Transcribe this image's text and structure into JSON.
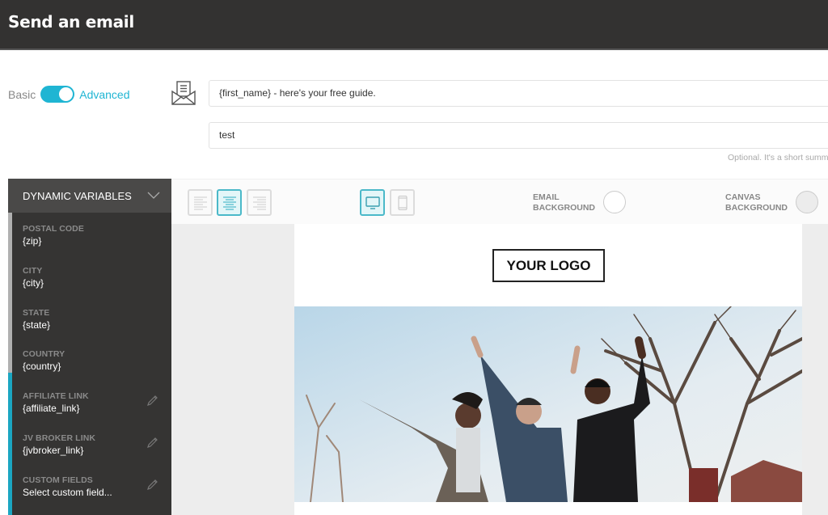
{
  "header": {
    "title": "Send an email"
  },
  "mode_toggle": {
    "left_label": "Basic",
    "right_label": "Advanced",
    "state": "advanced"
  },
  "subject": {
    "value": "{first_name} - here's your free guide."
  },
  "preview_text": {
    "value": "test",
    "hint": "Optional. It's a short summ"
  },
  "sidebar": {
    "title": "DYNAMIC VARIABLES",
    "items": [
      {
        "label": "POSTAL CODE",
        "value": "{zip}",
        "editable": false
      },
      {
        "label": "CITY",
        "value": "{city}",
        "editable": false
      },
      {
        "label": "STATE",
        "value": "{state}",
        "editable": false
      },
      {
        "label": "COUNTRY",
        "value": "{country}",
        "editable": false
      },
      {
        "label": "AFFILIATE LINK",
        "value": "{affiliate_link}",
        "editable": true
      },
      {
        "label": "JV BROKER LINK",
        "value": "{jvbroker_link}",
        "editable": true
      },
      {
        "label": "CUSTOM FIELDS",
        "value": "Select custom field...",
        "editable": true
      }
    ]
  },
  "toolbar": {
    "align_options": [
      "align-left",
      "align-center",
      "align-right"
    ],
    "align_selected": "align-center",
    "view_options": [
      "desktop",
      "mobile"
    ],
    "view_selected": "desktop",
    "email_background": {
      "line1": "EMAIL",
      "line2": "BACKGROUND",
      "color": "#ffffff"
    },
    "canvas_background": {
      "line1": "CANVAS",
      "line2": "BACKGROUND",
      "color": "#ededed"
    }
  },
  "email": {
    "logo_text": "YOUR LOGO",
    "hero_image_alt": "Three friends jumping outdoors under bare trees"
  },
  "colors": {
    "accent": "#1fb5d3",
    "header_bg": "#333231",
    "sidebar_bg": "#353433"
  }
}
